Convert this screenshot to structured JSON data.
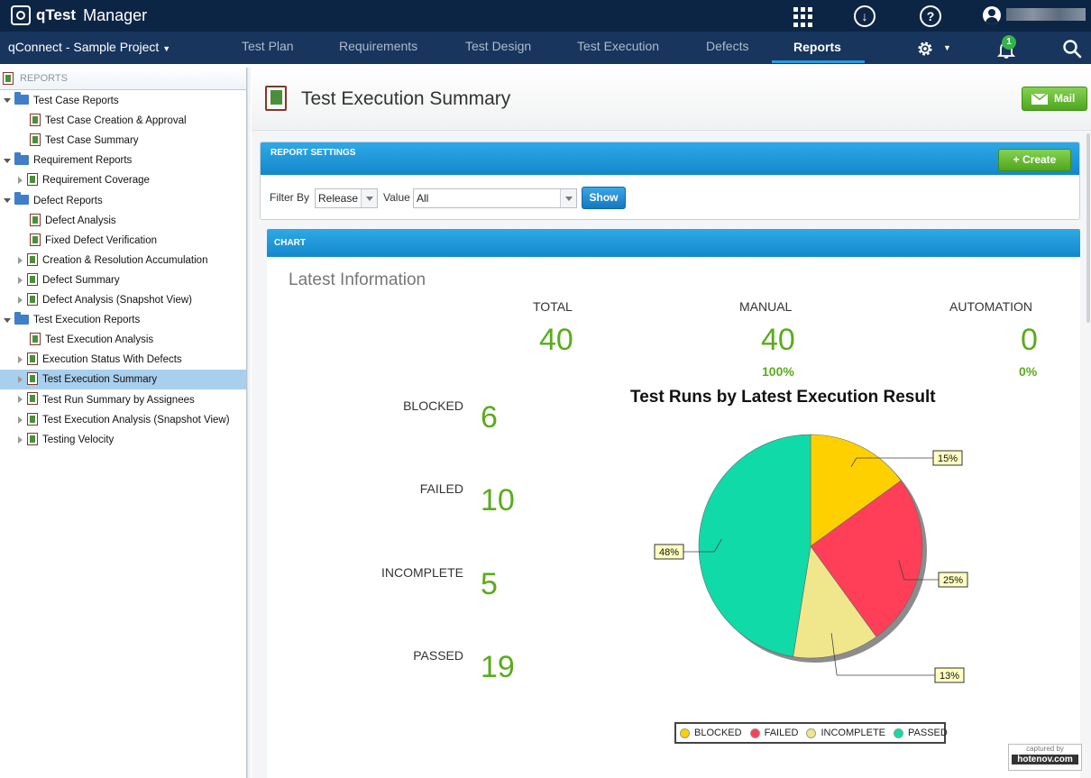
{
  "app": {
    "brand": "qTest",
    "product": "Manager"
  },
  "nav": {
    "project": "qConnect - Sample Project",
    "tabs": [
      {
        "label": "Test Plan"
      },
      {
        "label": "Requirements"
      },
      {
        "label": "Test Design"
      },
      {
        "label": "Test Execution"
      },
      {
        "label": "Defects"
      },
      {
        "label": "Reports",
        "active": true
      }
    ],
    "notification_count": "1"
  },
  "sidebar": {
    "header": "REPORTS",
    "items": [
      {
        "label": "Test Case Reports",
        "type": "folder"
      },
      {
        "label": "Test Case Creation & Approval",
        "type": "report"
      },
      {
        "label": "Test Case Summary",
        "type": "report"
      },
      {
        "label": "Requirement Reports",
        "type": "folder"
      },
      {
        "label": "Requirement Coverage",
        "type": "report",
        "expandable": true
      },
      {
        "label": "Defect Reports",
        "type": "folder"
      },
      {
        "label": "Defect Analysis",
        "type": "report"
      },
      {
        "label": "Fixed Defect Verification",
        "type": "report"
      },
      {
        "label": "Creation & Resolution Accumulation",
        "type": "report",
        "expandable": true
      },
      {
        "label": "Defect Summary",
        "type": "report",
        "expandable": true
      },
      {
        "label": "Defect Analysis (Snapshot View)",
        "type": "report",
        "expandable": true
      },
      {
        "label": "Test Execution Reports",
        "type": "folder"
      },
      {
        "label": "Test Execution Analysis",
        "type": "report"
      },
      {
        "label": "Execution Status With Defects",
        "type": "report",
        "expandable": true
      },
      {
        "label": "Test Execution Summary",
        "type": "report",
        "expandable": true,
        "selected": true
      },
      {
        "label": "Test Run Summary by Assignees",
        "type": "report",
        "expandable": true
      },
      {
        "label": "Test Execution Analysis (Snapshot View)",
        "type": "report",
        "expandable": true
      },
      {
        "label": "Testing Velocity",
        "type": "report",
        "expandable": true
      }
    ]
  },
  "page": {
    "title": "Test Execution Summary",
    "mail_label": "Mail"
  },
  "settings": {
    "header": "REPORT SETTINGS",
    "create_label": "+  Create",
    "filter_label": "Filter By",
    "filter_value": "Release",
    "value_label": "Value",
    "value_value": "All",
    "show_label": "Show"
  },
  "chart_panel": {
    "header": "CHART",
    "latest": "Latest Information",
    "totals": [
      {
        "label": "TOTAL",
        "value": "40",
        "pct": ""
      },
      {
        "label": "MANUAL",
        "value": "40",
        "pct": "100%"
      },
      {
        "label": "AUTOMATION",
        "value": "0",
        "pct": "0%"
      }
    ],
    "statuses": [
      {
        "label": "BLOCKED",
        "value": "6"
      },
      {
        "label": "FAILED",
        "value": "10"
      },
      {
        "label": "INCOMPLETE",
        "value": "5"
      },
      {
        "label": "PASSED",
        "value": "19"
      }
    ]
  },
  "chart_data": {
    "type": "pie",
    "title": "Test Runs by Latest Execution Result",
    "categories": [
      "BLOCKED",
      "FAILED",
      "INCOMPLETE",
      "PASSED"
    ],
    "values": [
      6,
      10,
      5,
      19
    ],
    "data_labels": [
      "15%",
      "25%",
      "13%",
      "48%"
    ],
    "colors": [
      "#ffd000",
      "#ff3f57",
      "#f0e68c",
      "#10dba8"
    ],
    "legend": "bottom"
  },
  "watermark": {
    "top": "captured by",
    "bottom": "hotenov.com"
  }
}
